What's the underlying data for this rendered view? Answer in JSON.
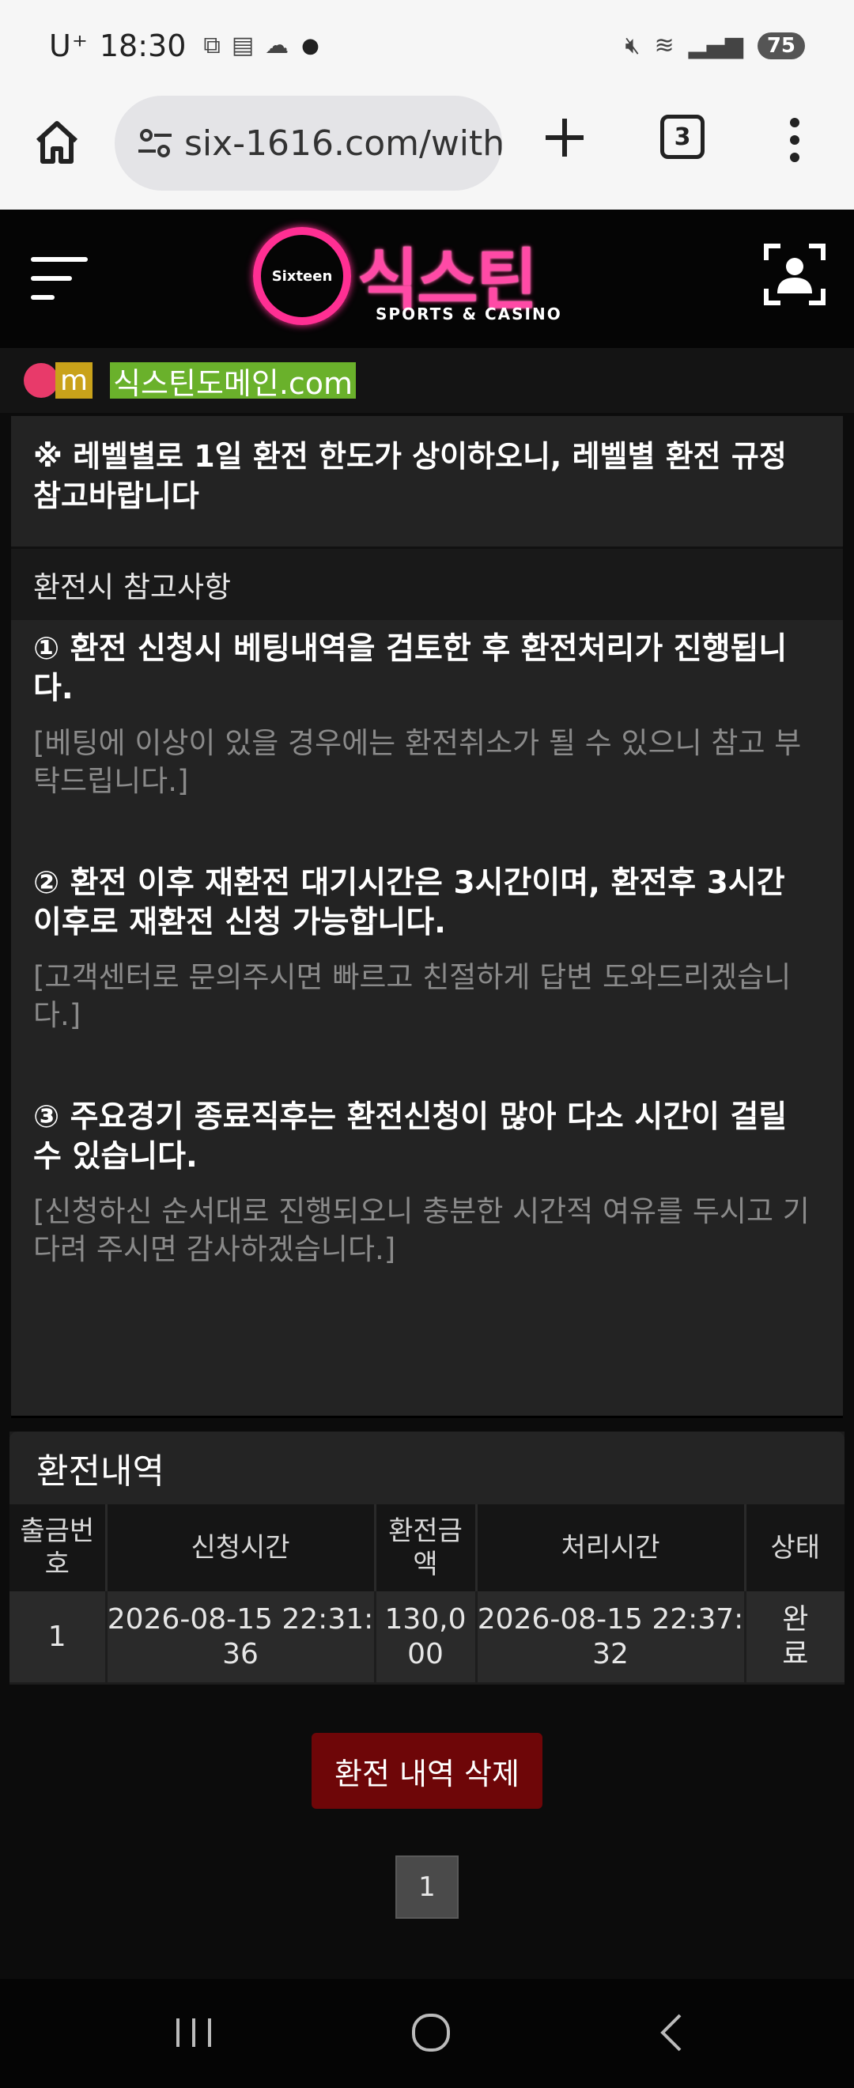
{
  "status_bar": {
    "carrier": "U⁺",
    "time": "18:30",
    "battery": "75"
  },
  "browser": {
    "url": "six-1616.com/with",
    "tab_count": "3"
  },
  "header": {
    "logo_title": "식스틴",
    "logo_badge": "Sixteen",
    "logo_subtitle": "SPORTS & CASINO"
  },
  "marquee": {
    "prefix": "m",
    "domain": "식스틴도메인.com"
  },
  "notice": {
    "level_notice": "※ 레벨별로 1일 환전 한도가 상이하오니, 레벨별 환전 규정 참고바랍니다",
    "section_title": "환전시 참고사항",
    "items": [
      {
        "title": "① 환전 신청시 베팅내역을 검토한 후 환전처리가 진행됩니다.",
        "note": "[베팅에 이상이 있을 경우에는 환전취소가 될 수 있으니 참고 부탁드립니다.]"
      },
      {
        "title": "② 환전 이후 재환전 대기시간은 3시간이며, 환전후 3시간 이후로 재환전 신청 가능합니다.",
        "note": "[고객센터로 문의주시면 빠르고 친절하게 답변 도와드리겠습니다.]"
      },
      {
        "title": "③ 주요경기 종료직후는 환전신청이 많아 다소 시간이 걸릴 수 있습니다.",
        "note": "[신청하신 순서대로 진행되오니 충분한 시간적 여유를 두시고 기다려 주시면 감사하겠습니다.]"
      }
    ]
  },
  "history": {
    "title": "환전내역",
    "columns": [
      "출금번호",
      "신청시간",
      "환전금액",
      "처리시간",
      "상태"
    ],
    "rows": [
      {
        "no": "1",
        "requested": "2026-08-15 22:31:36",
        "amount": "130,000",
        "processed": "2026-08-15 22:37:32",
        "status": "완료"
      }
    ],
    "delete_label": "환전 내역 삭제",
    "page": "1"
  },
  "colors": {
    "accent_pink": "#ff2f93",
    "delete_red": "#6e0608",
    "domain_green": "#6ab12b"
  }
}
